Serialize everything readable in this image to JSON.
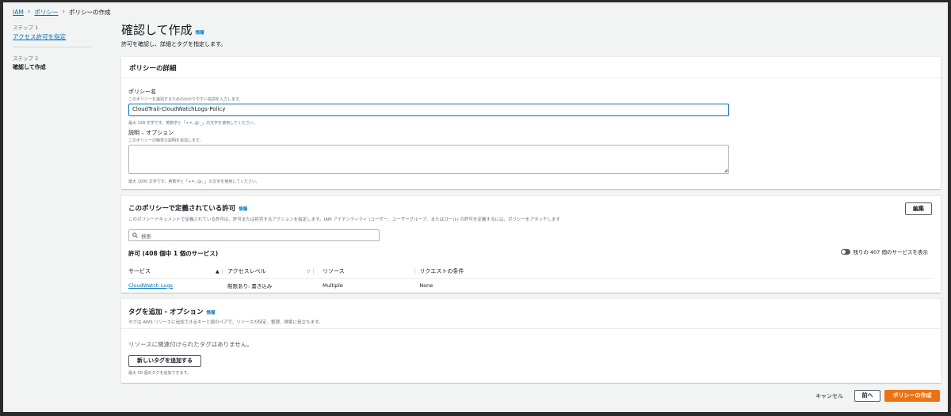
{
  "breadcrumb": {
    "items": [
      "IAM",
      "ポリシー",
      "ポリシーの作成"
    ]
  },
  "steps": {
    "step1_num": "ステップ 1",
    "step1_label": "アクセス許可を指定",
    "step2_num": "ステップ 2",
    "step2_label": "確認して作成"
  },
  "header": {
    "title": "確認して作成",
    "info": "情報",
    "subtitle": "許可を確認し、詳細とタグを指定します。"
  },
  "details": {
    "heading": "ポリシーの詳細",
    "name_label": "ポリシー名",
    "name_desc": "このポリシーを識別するためのわかりやすい名前を入力します。",
    "name_value": "CloudTrail-CloudWatchLogs-Policy",
    "name_hint": "最大 128 文字です。英数字と「+=,.@-_」の文字を使用してください。",
    "desc_label": "説明 – オプション",
    "desc_desc": "このポリシーの簡単な説明を追加します。",
    "desc_value": "",
    "desc_hint": "最大 1000 文字です。英数字と「+=,.@-_」の文字を使用してください。"
  },
  "permissions": {
    "heading": "このポリシーで定義されている許可",
    "info": "情報",
    "desc": "このポリシードキュメントで定義されている許可は、許可または拒否するアクションを指定します。IAM アイデンティティ (ユーザー、ユーザーグループ、またはロール) の許可を定義するには、ポリシーをアタッチします",
    "edit_button": "編集",
    "search_placeholder": "検索",
    "count_label": "許可 (408 個中 1 個のサービス)",
    "toggle_label": "残りの 407 個のサービスを表示",
    "columns": [
      "サービス",
      "アクセスレベル",
      "リソース",
      "リクエストの条件"
    ],
    "rows": [
      {
        "service": "CloudWatch Logs",
        "access": "制限あり: 書き込み",
        "resource": "Multiple",
        "condition": "None"
      }
    ]
  },
  "tags": {
    "heading": "タグを追加 - オプション",
    "info": "情報",
    "desc": "タグは AWS リソースに追加できるキーと値のペアで、リソースの特定、整理、検索に役立ちます。",
    "empty_text": "リソースに関連付けられたタグはありません。",
    "add_button": "新しいタグを追加する",
    "hint": "最大 50 個のタグを追加できます。"
  },
  "footer": {
    "cancel": "キャンセル",
    "back": "前へ",
    "create": "ポリシーの作成"
  },
  "colors": {
    "link": "#0073bb",
    "primary": "#ec7211",
    "background": "#f2f3f3"
  }
}
